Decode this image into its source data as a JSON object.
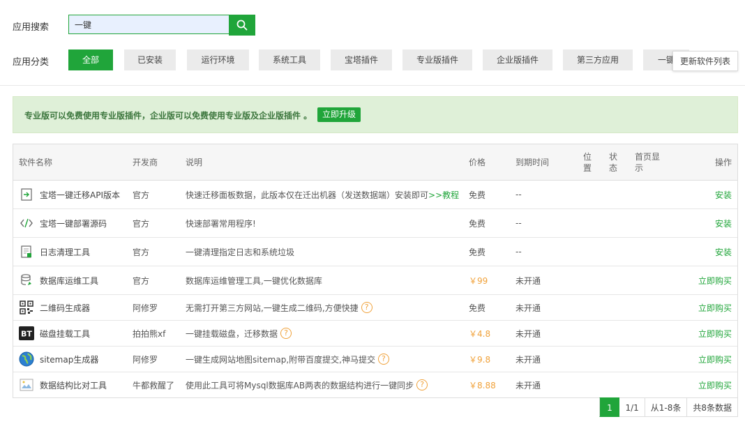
{
  "search": {
    "label": "应用搜索",
    "value": "一键"
  },
  "categories": {
    "label": "应用分类",
    "items": [
      "全部",
      "已安装",
      "运行环境",
      "系统工具",
      "宝塔插件",
      "专业版插件",
      "企业版插件",
      "第三方应用",
      "一键"
    ],
    "refresh": "更新软件列表"
  },
  "notice": {
    "text": "专业版可以免费使用专业版插件，企业版可以免费使用专业版及企业版插件 。",
    "upgrade": "立即升级"
  },
  "table": {
    "headers": {
      "name": "软件名称",
      "dev": "开发商",
      "desc": "说明",
      "price": "价格",
      "expire": "到期时间",
      "pos_a": "位",
      "pos_b": "置",
      "status_a": "状",
      "status_b": "态",
      "home_a": "首页显",
      "home_b": "示",
      "op": "操作"
    },
    "rows": [
      {
        "icon": "migrate-icon",
        "name": "宝塔一键迁移API版本",
        "dev": "官方",
        "desc": "快速迁移面板数据，此版本仅在迁出机器（发送数据端）安装即可",
        "desc_link": ">>教程",
        "price": "免费",
        "expire": "--",
        "op": "安装"
      },
      {
        "icon": "code-icon",
        "name": "宝塔一键部署源码",
        "dev": "官方",
        "desc": "快速部署常用程序!",
        "price": "免费",
        "expire": "--",
        "op": "安装"
      },
      {
        "icon": "log-clean-icon",
        "name": "日志清理工具",
        "dev": "官方",
        "desc": "一键清理指定日志和系统垃圾",
        "price": "免费",
        "expire": "--",
        "op": "安装"
      },
      {
        "icon": "database-icon",
        "name": "数据库运维工具",
        "dev": "官方",
        "desc": "数据库运维管理工具,一键优化数据库",
        "price": "￥99",
        "expire": "未开通",
        "op": "立即购买"
      },
      {
        "icon": "qrcode-icon",
        "name": "二维码生成器",
        "dev": "阿修罗",
        "desc": "无需打开第三方网站,一键生成二维码,方便快捷",
        "help": "?",
        "price": "免费",
        "expire": "未开通",
        "op": "立即购买"
      },
      {
        "icon": "bt-disk-icon",
        "name": "磁盘挂载工具",
        "dev": "拍拍熊xf",
        "desc": "一键挂载磁盘，迁移数据",
        "help": "?",
        "price": "￥4.8",
        "expire": "未开通",
        "op": "立即购买"
      },
      {
        "icon": "globe-icon",
        "name": "sitemap生成器",
        "dev": "阿修罗",
        "desc": "一键生成网站地图sitemap,附带百度提交,神马提交",
        "help": "?",
        "price": "￥9.8",
        "expire": "未开通",
        "op": "立即购买"
      },
      {
        "icon": "broken-image-icon",
        "name": "数据结构比对工具",
        "dev": "牛都救醒了",
        "desc": "使用此工具可将Mysql数据库AB两表的数据结构进行一键同步",
        "help": "?",
        "price": "￥8.88",
        "expire": "未开通",
        "op": "立即购买"
      }
    ]
  },
  "pagination": {
    "current": "1",
    "total_pages": "1/1",
    "range": "从1-8条",
    "count": "共8条数据"
  },
  "colors": {
    "accent": "#20a53a",
    "price": "#f0a139",
    "notice_bg": "#dff0d8"
  }
}
